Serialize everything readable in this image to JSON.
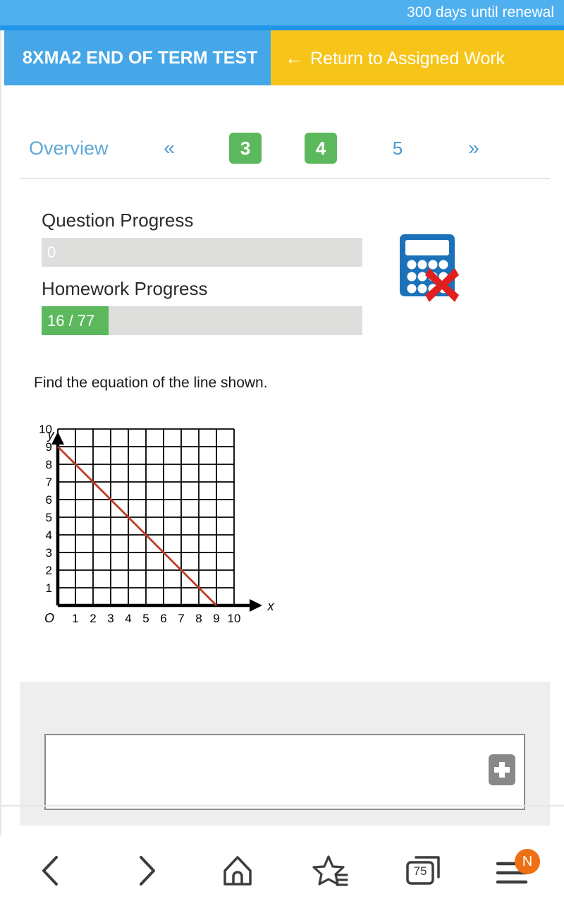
{
  "banner": {
    "renewal_text": "300 days until renewal",
    "bg_color": "#4fb0ef",
    "underbar_color": "#2196e8"
  },
  "titlebar": {
    "assignment_title": "8XMA2 END OF TERM TEST",
    "assignment_title_bg": "#46a7e8",
    "return_label": "Return to Assigned Work",
    "return_arrow": "←",
    "return_bg": "#f7c51a"
  },
  "pager": {
    "overview_label": "Overview",
    "prev_label": "«",
    "next_label": "»",
    "pages": [
      {
        "label": "3",
        "active": true
      },
      {
        "label": "4",
        "active": true
      },
      {
        "label": "5",
        "active": false
      }
    ],
    "active_color": "#5cb85c",
    "link_color": "#4b9cd3"
  },
  "progress": {
    "question": {
      "label": "Question Progress",
      "value_text": "0",
      "percent": 0
    },
    "homework": {
      "label": "Homework Progress",
      "value_text": "16 / 77",
      "percent": 20.8,
      "completed": 16,
      "total": 77
    },
    "fill_color": "#5cb85c",
    "track_color": "#dededd"
  },
  "calculator": {
    "icon_name": "calculator-not-allowed-icon",
    "body_color": "#1b72b8",
    "cross_color": "#e02020"
  },
  "question": {
    "prompt": "Find the equation of the line shown.",
    "answer_value": "",
    "answer_placeholder": "",
    "add_button_label": "+"
  },
  "chart_data": {
    "type": "line",
    "title": "",
    "xlabel": "x",
    "ylabel": "y",
    "origin_label": "O",
    "xlim": [
      0,
      10
    ],
    "ylim": [
      0,
      10
    ],
    "x_ticks": [
      1,
      2,
      3,
      4,
      5,
      6,
      7,
      8,
      9,
      10
    ],
    "y_ticks": [
      1,
      2,
      3,
      4,
      5,
      6,
      7,
      8,
      9,
      10
    ],
    "grid": true,
    "grid_color": "#000000",
    "series": [
      {
        "name": "line",
        "color": "#c0392b",
        "points": [
          [
            0,
            9
          ],
          [
            9,
            0
          ]
        ],
        "equation": "y = -x + 9",
        "slope": -1,
        "y_intercept": 9,
        "x_intercept": 9
      }
    ]
  },
  "browser_bar": {
    "items": [
      {
        "icon": "chevron-left-icon",
        "name": "back"
      },
      {
        "icon": "chevron-right-icon",
        "name": "forward"
      },
      {
        "icon": "home-icon",
        "name": "home"
      },
      {
        "icon": "bookmark-star-icon",
        "name": "bookmarks"
      },
      {
        "icon": "tabs-icon",
        "name": "tabs"
      },
      {
        "icon": "menu-icon",
        "name": "menu"
      }
    ],
    "tab_count": "75",
    "menu_badge": "N",
    "menu_badge_color": "#ed7014"
  }
}
